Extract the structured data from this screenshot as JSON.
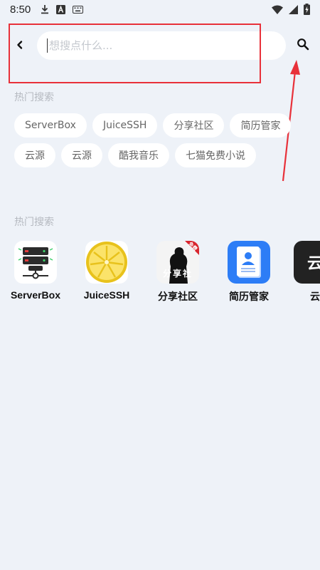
{
  "status_bar": {
    "time": "8:50",
    "left_icons": [
      "download-icon",
      "font-a-icon",
      "keyboard-icon"
    ],
    "right_icons": [
      "wifi-icon",
      "signal-icon",
      "battery-charging-icon"
    ]
  },
  "search": {
    "placeholder": "想搜点什么...",
    "value": ""
  },
  "hot_search": {
    "title": "热门搜索",
    "tags": [
      [
        "ServerBox",
        "JuiceSSH",
        "分享社区",
        "简历管家"
      ],
      [
        "云源",
        "云源",
        "酷我音乐",
        "七猫免费小说"
      ]
    ]
  },
  "hot_apps": {
    "title": "热门搜索",
    "apps": [
      {
        "name": "ServerBox",
        "icon": "serverbox-icon"
      },
      {
        "name": "JuiceSSH",
        "icon": "lemon-icon"
      },
      {
        "name": "分享社区",
        "icon": "share-community-icon",
        "badge": "免费",
        "icon_text": "分享社"
      },
      {
        "name": "简历管家",
        "icon": "resume-icon"
      },
      {
        "name": "云",
        "icon": "cloud-source-icon",
        "icon_text": "云"
      }
    ]
  },
  "colors": {
    "background": "#eef2f8",
    "annotation_red": "#e8313a",
    "resume_blue": "#2d7df6",
    "lemon_yellow": "#f7d320"
  }
}
